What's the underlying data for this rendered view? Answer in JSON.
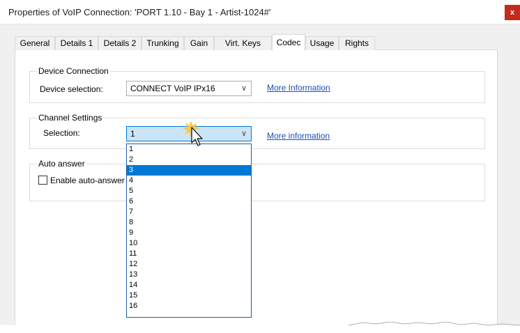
{
  "window": {
    "title": "Properties of VoIP Connection: 'PORT 1.10 - Bay 1 - Artist-1024#'",
    "close_label": "x"
  },
  "tabs": [
    "General",
    "Details 1",
    "Details 2",
    "Trunking",
    "Gain",
    "Virt. Keys",
    "Codec",
    "Usage",
    "Rights"
  ],
  "active_tab": "Codec",
  "device_connection": {
    "group_title": "Device Connection",
    "label": "Device selection:",
    "value": "CONNECT VoIP IPx16",
    "link": "More Information"
  },
  "channel_settings": {
    "group_title": "Channel Settings",
    "label": "Selection:",
    "value": "1",
    "link": "More information",
    "options": [
      "1",
      "2",
      "3",
      "4",
      "5",
      "6",
      "7",
      "8",
      "9",
      "10",
      "11",
      "12",
      "13",
      "14",
      "15",
      "16"
    ],
    "highlighted_option": "3"
  },
  "auto_answer": {
    "group_title": "Auto answer",
    "checkbox_label": "Enable auto-answer",
    "checked": false
  },
  "colors": {
    "accent": "#0078d7",
    "link": "#1a4db3",
    "close": "#c42b1c",
    "highlight_burst": "#f5c542"
  }
}
